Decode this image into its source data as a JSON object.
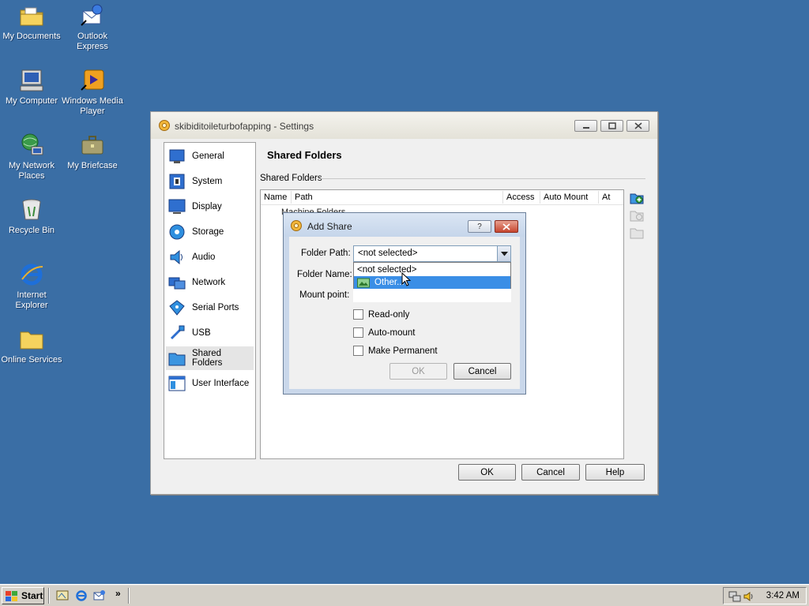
{
  "desktop": {
    "icons": [
      {
        "label": "My Documents",
        "icon": "folder-documents-icon"
      },
      {
        "label": "Outlook Express",
        "icon": "outlook-express-icon"
      },
      {
        "label": "My Computer",
        "icon": "my-computer-icon"
      },
      {
        "label": "Windows Media Player",
        "icon": "media-player-icon"
      },
      {
        "label": "My Network Places",
        "icon": "network-places-icon"
      },
      {
        "label": "My Briefcase",
        "icon": "briefcase-icon"
      },
      {
        "label": "Recycle Bin",
        "icon": "recycle-bin-icon"
      },
      {
        "label": "Internet Explorer",
        "icon": "internet-explorer-icon"
      },
      {
        "label": "Online Services",
        "icon": "folder-icon"
      }
    ]
  },
  "settings": {
    "title": "skibiditoileturbofapping - Settings",
    "sidebar": [
      {
        "label": "General",
        "icon": "general-icon"
      },
      {
        "label": "System",
        "icon": "system-chip-icon"
      },
      {
        "label": "Display",
        "icon": "display-monitor-icon"
      },
      {
        "label": "Storage",
        "icon": "storage-disc-icon"
      },
      {
        "label": "Audio",
        "icon": "audio-speaker-icon"
      },
      {
        "label": "Network",
        "icon": "network-icon"
      },
      {
        "label": "Serial Ports",
        "icon": "serial-port-icon"
      },
      {
        "label": "USB",
        "icon": "usb-icon"
      },
      {
        "label": "Shared Folders",
        "icon": "shared-folder-icon"
      },
      {
        "label": "User Interface",
        "icon": "user-interface-icon"
      }
    ],
    "active_section": "Shared Folders",
    "page_title": "Shared Folders",
    "group_label": "Shared Folders",
    "table": {
      "columns": [
        "Name",
        "Path",
        "Access",
        "Auto Mount",
        "At"
      ],
      "rows": [
        {
          "name": "Machine Folders"
        }
      ]
    },
    "buttons": {
      "ok": "OK",
      "cancel": "Cancel",
      "help": "Help"
    }
  },
  "add_share": {
    "title": "Add Share",
    "help_glyph": "?",
    "folder_path_label": "Folder Path:",
    "folder_path_value": "<not selected>",
    "folder_name_label": "Folder Name:",
    "mount_point_label": "Mount point:",
    "dropdown_options": [
      "<not selected>",
      "Other..."
    ],
    "selected_option": "Other...",
    "checkboxes": {
      "read_only": {
        "label": "Read-only",
        "checked": false
      },
      "auto_mount": {
        "label": "Auto-mount",
        "checked": false
      },
      "make_permanent": {
        "label": "Make Permanent",
        "checked": false
      }
    },
    "buttons": {
      "ok": "OK",
      "cancel": "Cancel"
    }
  },
  "taskbar": {
    "start_label": "Start",
    "clock": "3:42 AM",
    "chevron": "»"
  }
}
